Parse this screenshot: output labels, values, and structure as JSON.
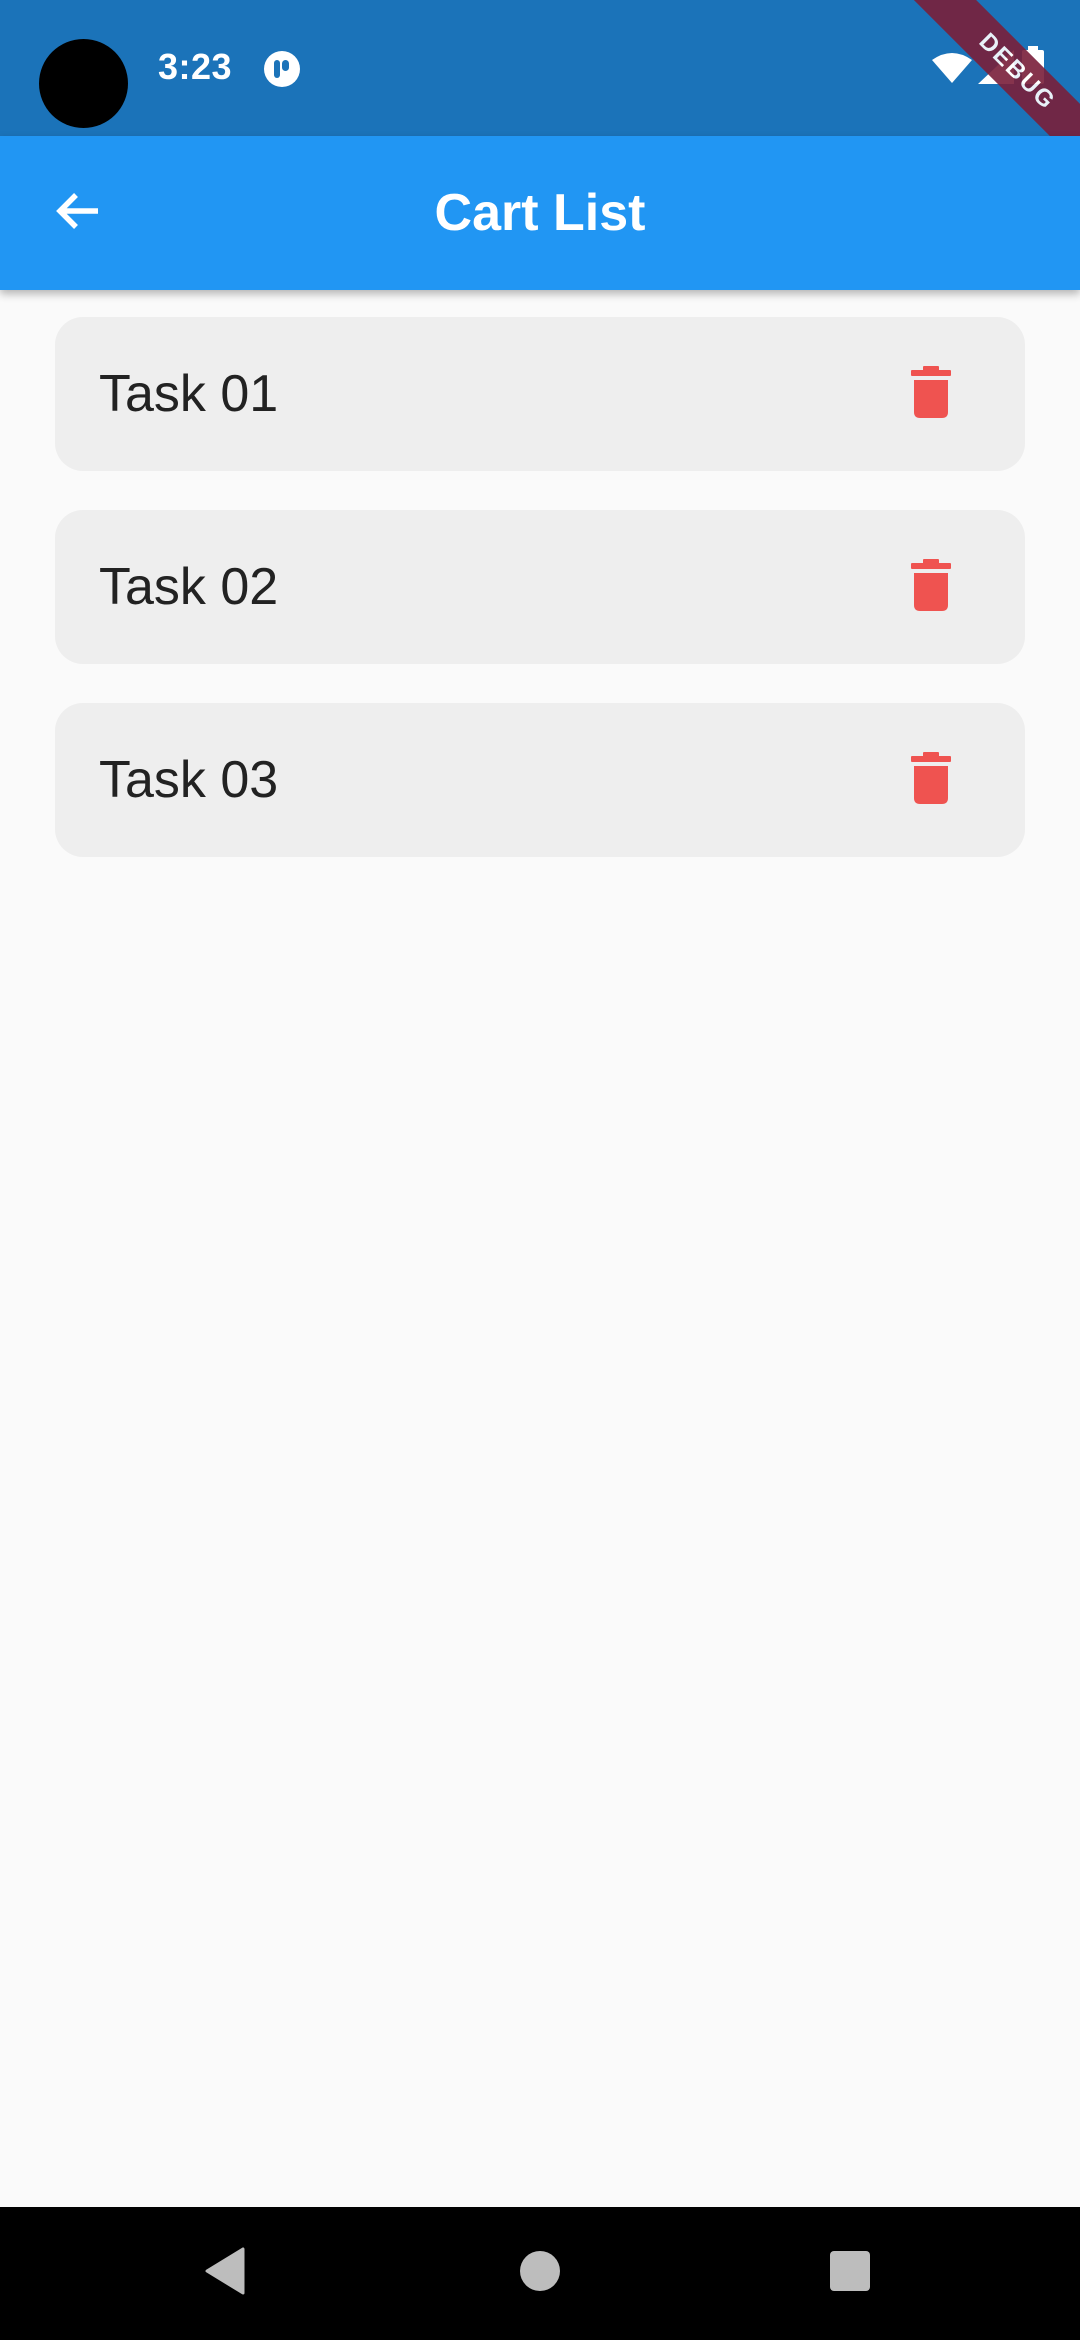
{
  "status_bar": {
    "time": "3:23",
    "debug_label": "DEBUG",
    "background_color": "#1b73b9",
    "icons": [
      "camera-hole",
      "notification-icon",
      "wifi-icon",
      "cellular-signal-icon",
      "battery-icon"
    ]
  },
  "app_bar": {
    "title": "Cart List",
    "back_icon": "arrow-back-icon",
    "background_color": "#2196f3"
  },
  "cart": {
    "items": [
      {
        "label": "Task 01",
        "action_icon": "delete-icon"
      },
      {
        "label": "Task 02",
        "action_icon": "delete-icon"
      },
      {
        "label": "Task 03",
        "action_icon": "delete-icon"
      }
    ],
    "item_background_color": "#eeeeee",
    "delete_icon_color": "#ef5350"
  },
  "nav_bar": {
    "buttons": [
      "back-triangle-icon",
      "home-circle-icon",
      "recents-square-icon"
    ]
  }
}
